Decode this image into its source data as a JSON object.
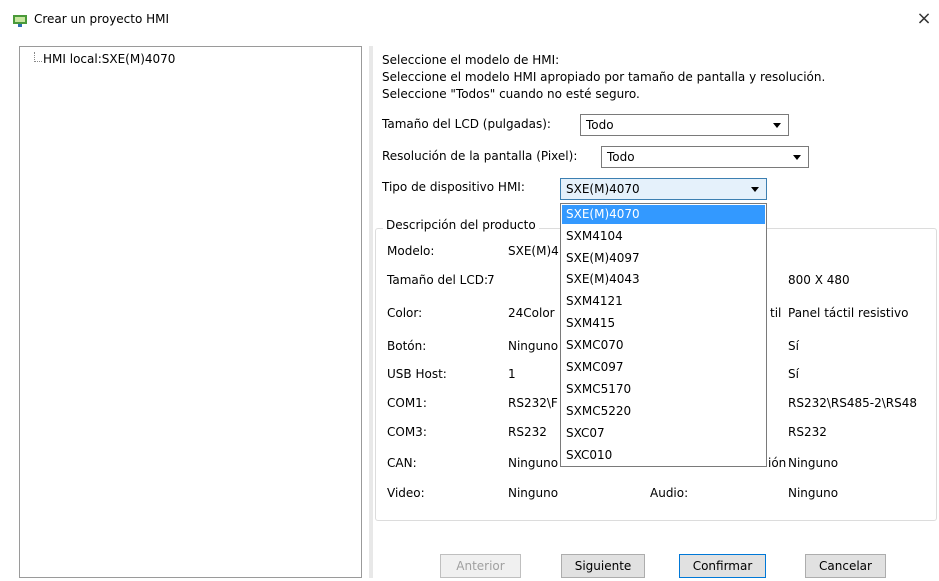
{
  "window": {
    "title": "Crear un proyecto HMI",
    "close": "×"
  },
  "tree": {
    "items": [
      "HMI local:SXE(M)4070"
    ]
  },
  "instructions": {
    "line1": "Seleccione el modelo de HMI:",
    "line2": "Seleccione el modelo HMI apropiado por tamaño de pantalla y resolución.",
    "line3": "Seleccione \"Todos\" cuando no esté seguro."
  },
  "lcd_size": {
    "label": "Tamaño del LCD (pulgadas):",
    "value": "Todo"
  },
  "resolution": {
    "label": "Resolución de la pantalla (Pixel):",
    "value": "Todo"
  },
  "device_type": {
    "label": "Tipo de dispositivo HMI:",
    "value": "SXE(M)4070",
    "options": [
      "SXE(M)4070",
      "SXM4104",
      "SXE(M)4097",
      "SXE(M)4043",
      "SXM4121",
      "SXM415",
      "SXMC070",
      "SXMC097",
      "SXMC5170",
      "SXMC5220",
      "SXC07",
      "SXC010"
    ],
    "selected_index": 0
  },
  "product": {
    "legend": "Descripción del producto",
    "rows": [
      {
        "l1": "Modelo:",
        "v1": "SXE(M)4",
        "l2": "",
        "v2": ""
      },
      {
        "l1": "Tamaño del LCD:",
        "v1": "7",
        "l2": "",
        "v2": "800 X 480"
      },
      {
        "l1": "Color:",
        "v1": "24Color",
        "l2": "til",
        "v2": "Panel táctil resistivo"
      },
      {
        "l1": "Botón:",
        "v1": "Ninguno",
        "l2": "",
        "v2": "Sí"
      },
      {
        "l1": "USB Host:",
        "v1": "1",
        "l2": "",
        "v2": "Sí"
      },
      {
        "l1": "COM1:",
        "v1": "RS232\\F",
        "l2": "",
        "v2": "RS232\\RS485-2\\RS48"
      },
      {
        "l1": "COM3:",
        "v1": "RS232",
        "l2": "",
        "v2": "RS232"
      },
      {
        "l1": "CAN:",
        "v1": "Ninguno",
        "l2": "ión",
        "v2": "Ninguno"
      },
      {
        "l1": "Video:",
        "v1": "Ninguno",
        "l2": "Audio:",
        "v2": "Ninguno"
      }
    ]
  },
  "buttons": {
    "prev": "Anterior",
    "next": "Siguiente",
    "confirm": "Confirmar",
    "cancel": "Cancelar"
  }
}
